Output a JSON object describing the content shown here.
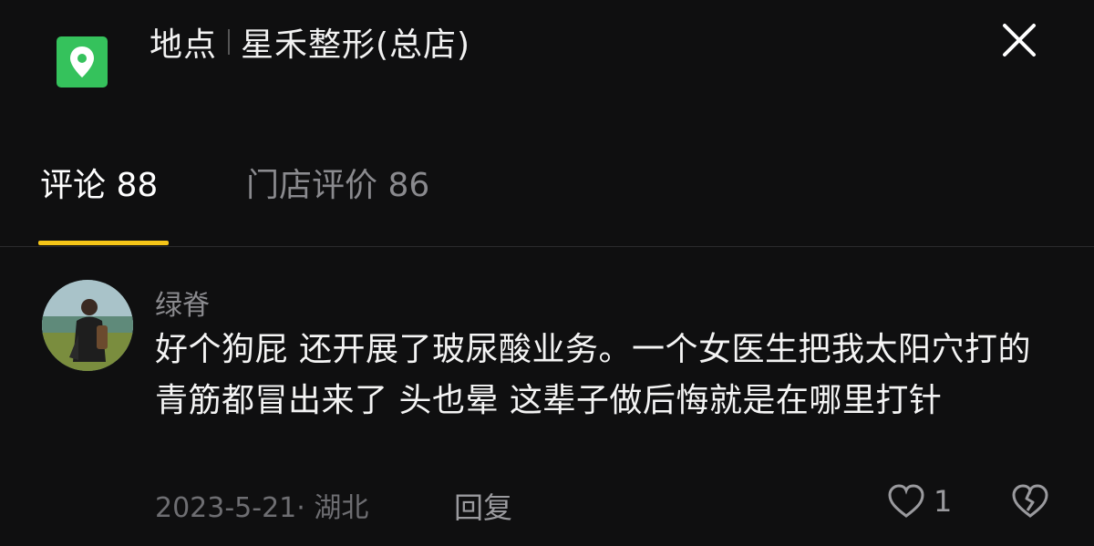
{
  "header": {
    "icon": "location-pin-icon",
    "label": "地点",
    "place": "星禾整形(总店)",
    "close_icon": "close-icon",
    "accent": "#35c25c"
  },
  "tabs": [
    {
      "label": "评论 88",
      "active": true
    },
    {
      "label": "门店评价 86",
      "active": false
    }
  ],
  "tab_accent": "#f5c518",
  "comment": {
    "avatar": "avatar",
    "username": "绿脊",
    "text": "好个狗屁 还开展了玻尿酸业务。一个女医生把我太阳穴打的青筋都冒出来了 头也晕 这辈子做后悔就是在哪里打针",
    "meta": "2023-5-21· 湖北",
    "reply_label": "回复",
    "like_count": "1",
    "like_icon": "heart-icon",
    "dislike_icon": "broken-heart-icon"
  }
}
